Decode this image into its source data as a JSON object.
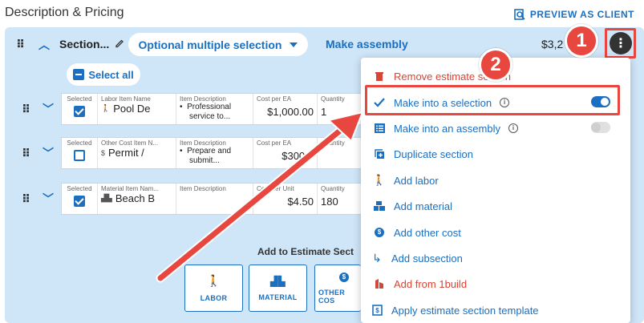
{
  "page": {
    "title": "Description & Pricing",
    "preview_label": "PREVIEW AS CLIENT"
  },
  "section": {
    "name": "Section...",
    "mode_label": "Optional multiple selection",
    "make_assembly": "Make assembly",
    "amount": "$3,2",
    "select_all": "Select all"
  },
  "rows": [
    {
      "selected_label": "Selected",
      "checked": true,
      "type_label": "Labor Item Name",
      "name": "Pool De",
      "icon": "person-walking-icon",
      "desc_label": "Item Description",
      "desc": [
        "Professional",
        "service to..."
      ],
      "cost_label": "Cost per EA",
      "cost": "$1,000.00",
      "qty_label": "Quantity",
      "qty": "1"
    },
    {
      "selected_label": "Selected",
      "checked": false,
      "type_label": "Other Cost Item N...",
      "name": "Permit /",
      "icon": "dollar-circle-icon",
      "desc_label": "Item Description",
      "desc": [
        "Prepare and",
        "submit..."
      ],
      "cost_label": "Cost per EA",
      "cost": "$300.0",
      "qty_label": "Quantity",
      "qty": ""
    },
    {
      "selected_label": "Selected",
      "checked": true,
      "type_label": "Material Item Nam...",
      "name": "Beach B",
      "icon": "bricks-icon",
      "desc_label": "Item Description",
      "desc": [],
      "cost_label": "Cost per Unit",
      "cost": "$4.50",
      "qty_label": "Quantity",
      "qty": "180"
    }
  ],
  "add_section": {
    "title": "Add to Estimate Sect",
    "buttons": [
      {
        "label": "LABOR",
        "icon": "person-walking-icon"
      },
      {
        "label": "MATERIAL",
        "icon": "bricks-icon"
      },
      {
        "label": "OTHER COS",
        "icon": "dollar-circle-icon"
      }
    ]
  },
  "menu": {
    "items": [
      {
        "label": "Remove estimate section",
        "icon": "trash-icon",
        "color": "#d64535"
      },
      {
        "label": "Make into a selection",
        "icon": "check-icon",
        "color": "#1a6fc1",
        "info": true,
        "toggle": true
      },
      {
        "label": "Make into an assembly",
        "icon": "list-icon",
        "color": "#1a6fc1",
        "info": true,
        "toggle": false
      },
      {
        "label": "Duplicate section",
        "icon": "duplicate-icon",
        "color": "#1a6fc1"
      },
      {
        "label": "Add labor",
        "icon": "person-walking-icon",
        "color": "#1a6fc1"
      },
      {
        "label": "Add material",
        "icon": "bricks-icon",
        "color": "#1a6fc1"
      },
      {
        "label": "Add other cost",
        "icon": "dollar-circle-icon",
        "color": "#1a6fc1"
      },
      {
        "label": "Add subsection",
        "icon": "subdirectory-arrow-icon",
        "color": "#1a6fc1"
      },
      {
        "label": "Add from 1build",
        "icon": "1build-logo-icon",
        "color": "#d64535"
      },
      {
        "label": "Apply estimate section template",
        "icon": "template-icon",
        "color": "#1a6fc1"
      }
    ]
  },
  "annotations": {
    "badge1": "1",
    "badge2": "2",
    "color": "#e8473f"
  }
}
